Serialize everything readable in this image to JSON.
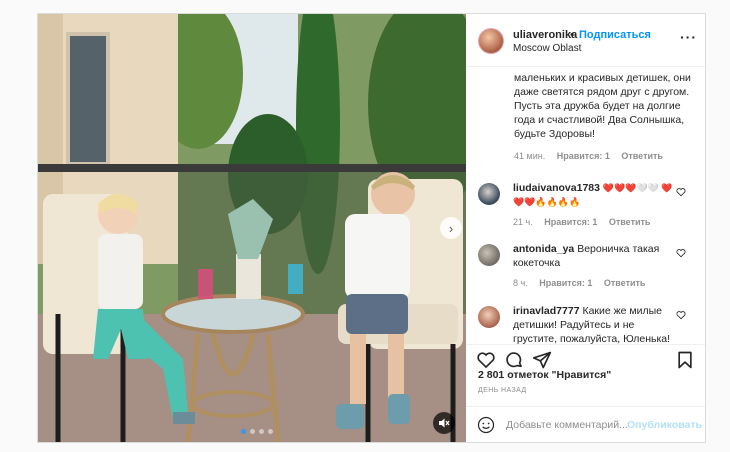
{
  "post": {
    "username": "uliaveronika",
    "separator": "•",
    "follow_label": "Подписаться",
    "location": "Moscow Oblast",
    "more_glyph": "···",
    "carousel": {
      "slides": 4,
      "current": 1
    }
  },
  "caption": {
    "text": "маленьких и красивых детишек, они даже светятся рядом друг с другом. Пусть эта дружба будет на долгие года и счастливой! Два Солнышка, будьте Здоровы!",
    "time": "41 мин.",
    "likes": "Нравится: 1",
    "reply": "Ответить"
  },
  "comments": [
    {
      "user": "liudaivanova1783",
      "text": "❤️❤️❤️🤍🤍 ❤️❤️❤️🔥🔥🔥🔥",
      "time": "21 ч.",
      "likes": "Нравится: 1",
      "reply": "Ответить"
    },
    {
      "user": "antonida_ya",
      "text": "Вероничка такая кокеточка",
      "time": "8 ч.",
      "likes": "Нравится: 1",
      "reply": "Ответить"
    },
    {
      "user": "irinavlad7777",
      "text": "Какие же милые детишки! Радуйтесь и не грустите, пожалуйста, Юленька!",
      "time": "",
      "likes": "",
      "reply": ""
    }
  ],
  "stats": {
    "likes_text": "2 801 отметок \"Нравится\"",
    "date": "ДЕНЬ НАЗАД"
  },
  "composer": {
    "placeholder": "Добавьте комментарий...",
    "publish_label": "Опубликовать"
  },
  "colors": {
    "accent": "#0095f6",
    "publish_disabled": "#b2dffc",
    "text": "#262626",
    "muted": "#8e8e8e"
  }
}
